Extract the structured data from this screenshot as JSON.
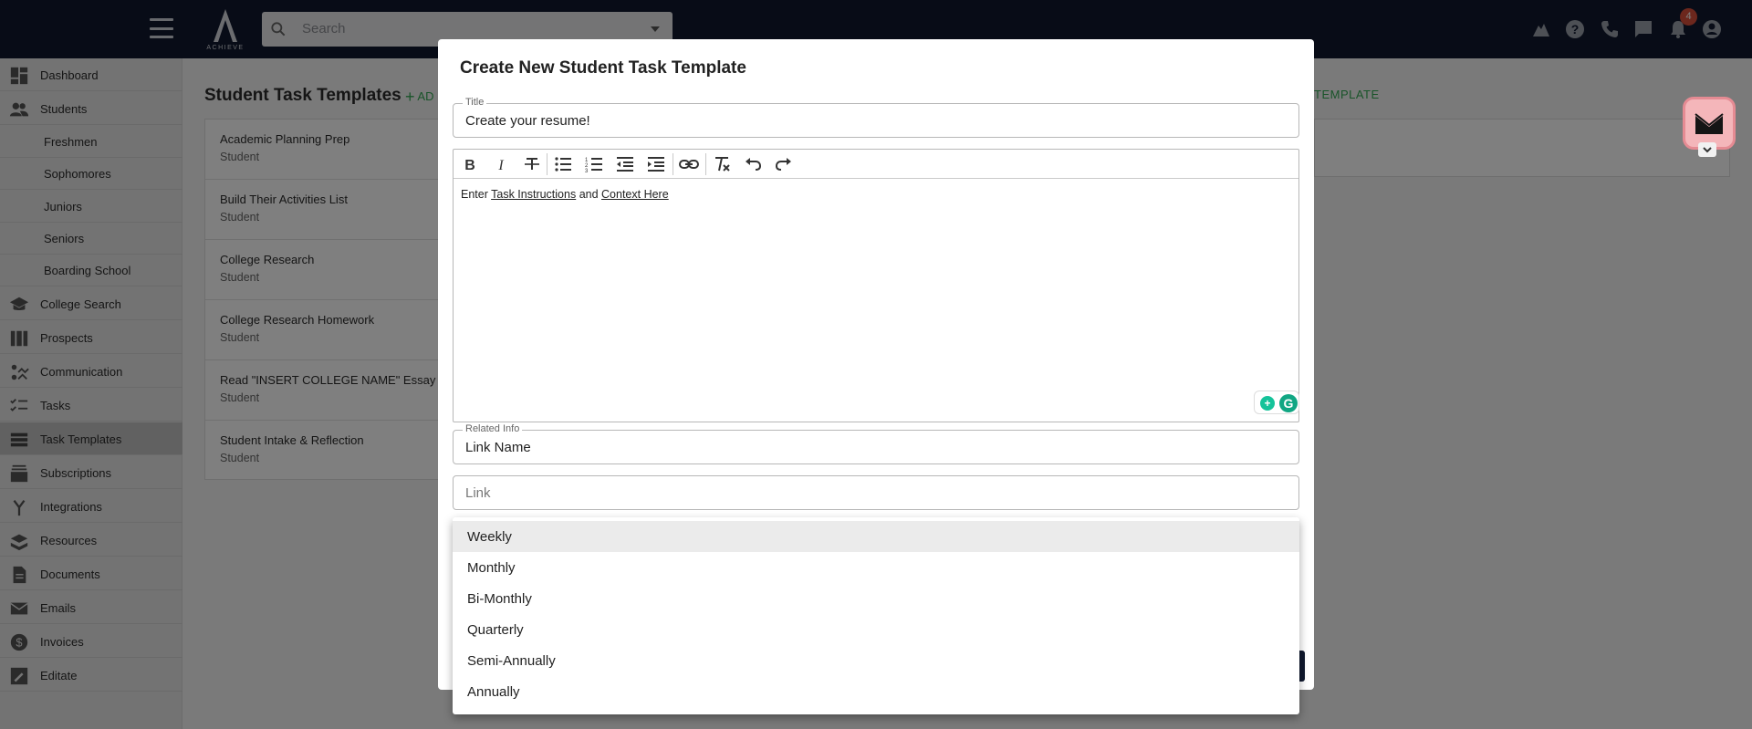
{
  "topbar": {
    "logo_text": "ACHIEVE",
    "search_placeholder": "Search",
    "notification_count": "4",
    "icons": [
      "hamburger-menu-icon",
      "search-icon",
      "dropdown-caret-icon",
      "graduation-hat-icon",
      "help-icon",
      "phone-icon",
      "chat-icon",
      "bell-icon",
      "account-icon"
    ]
  },
  "sidebar": {
    "items": [
      {
        "label": "Dashboard",
        "icon": "dashboard-icon"
      },
      {
        "label": "Students",
        "icon": "people-icon"
      },
      {
        "label": "Freshmen"
      },
      {
        "label": "Sophomores"
      },
      {
        "label": "Juniors"
      },
      {
        "label": "Seniors"
      },
      {
        "label": "Boarding School"
      },
      {
        "label": "College Search",
        "icon": "school-icon"
      },
      {
        "label": "Prospects",
        "icon": "columns-icon"
      },
      {
        "label": "Communication",
        "icon": "communication-icon"
      },
      {
        "label": "Tasks",
        "icon": "checklist-icon"
      },
      {
        "label": "Task Templates",
        "icon": "list-icon",
        "active": true
      },
      {
        "label": "Subscriptions",
        "icon": "subscriptions-icon"
      },
      {
        "label": "Integrations",
        "icon": "merge-icon"
      },
      {
        "label": "Resources",
        "icon": "resources-icon"
      },
      {
        "label": "Documents",
        "icon": "document-icon"
      },
      {
        "label": "Emails",
        "icon": "mail-icon"
      },
      {
        "label": "Invoices",
        "icon": "dollar-icon"
      },
      {
        "label": "Editate",
        "icon": "edit-note-icon"
      }
    ]
  },
  "page": {
    "title": "Student Task Templates",
    "add_label": "AD",
    "add_template_label": "TEMPLATE",
    "templates": [
      {
        "title": "Academic Planning Prep",
        "subtitle": "Student"
      },
      {
        "title": "Build Their Activities List",
        "subtitle": "Student"
      },
      {
        "title": "College Research",
        "subtitle": "Student"
      },
      {
        "title": "College Research Homework",
        "subtitle": "Student"
      },
      {
        "title": "Read \"INSERT COLLEGE NAME\" Essay Pro",
        "subtitle": "Student"
      },
      {
        "title": "Student Intake & Reflection",
        "subtitle": "Student"
      }
    ]
  },
  "modal": {
    "title": "Create New Student Task Template",
    "title_field": {
      "label": "Title",
      "value": "Create your resume!"
    },
    "editor": {
      "toolbar": [
        "bold-icon",
        "italic-icon",
        "strikethrough-icon",
        "bullet-list-icon",
        "numbered-list-icon",
        "outdent-icon",
        "indent-icon",
        "link-icon",
        "clear-format-icon",
        "undo-icon",
        "redo-icon"
      ],
      "text_prefix": "Enter ",
      "link_1": "Task Instructions",
      "text_middle": " and ",
      "link_2": "Context Here"
    },
    "related_info": {
      "label": "Related Info",
      "value": "Link Name"
    },
    "link_field": {
      "placeholder": "Link"
    }
  },
  "dropdown": {
    "selected": "Weekly",
    "options": [
      "Weekly",
      "Monthly",
      "Bi-Monthly",
      "Quarterly",
      "Semi-Annually",
      "Annually"
    ]
  },
  "colors": {
    "topbar": "#10192f",
    "accent_green": "#32a852",
    "badge": "#d84e3a"
  }
}
